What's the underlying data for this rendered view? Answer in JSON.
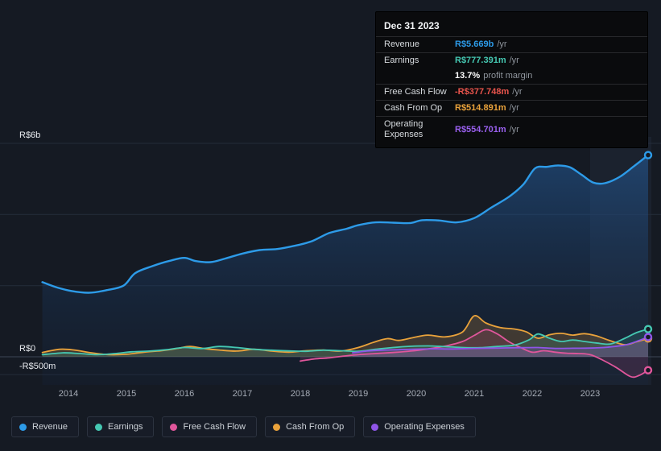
{
  "tooltip": {
    "title": "Dec 31 2023",
    "rows": [
      {
        "label": "Revenue",
        "value": "R$5.669b",
        "suffix": "/yr",
        "color": "#2d9be8",
        "divider": true
      },
      {
        "label": "Earnings",
        "value": "R$777.391m",
        "suffix": "/yr",
        "color": "#45c8b2",
        "divider": true
      },
      {
        "label": "",
        "value": "13.7%",
        "suffix": "profit margin",
        "color": "#ffffff",
        "divider": false
      },
      {
        "label": "Free Cash Flow",
        "value": "-R$377.748m",
        "suffix": "/yr",
        "color": "#e8544c",
        "divider": true
      },
      {
        "label": "Cash From Op",
        "value": "R$514.891m",
        "suffix": "/yr",
        "color": "#e9a23b",
        "divider": true
      },
      {
        "label": "Operating Expenses",
        "value": "R$554.701m",
        "suffix": "/yr",
        "color": "#9a60ef",
        "divider": true
      }
    ]
  },
  "legend": {
    "items": [
      {
        "key": "revenue",
        "label": "Revenue",
        "color": "#2d9be8"
      },
      {
        "key": "earnings",
        "label": "Earnings",
        "color": "#45c8b2"
      },
      {
        "key": "free_cash_flow",
        "label": "Free Cash Flow",
        "color": "#e0569b"
      },
      {
        "key": "cash_from_op",
        "label": "Cash From Op",
        "color": "#e9a23b"
      },
      {
        "key": "operating_expenses",
        "label": "Operating Expenses",
        "color": "#8f55e8"
      }
    ]
  },
  "chart_data": {
    "type": "line",
    "title": "Company financial history (R$, values in millions)",
    "currency": "R$",
    "x_axis": {
      "ticks": [
        2014,
        2015,
        2016,
        2017,
        2018,
        2019,
        2020,
        2021,
        2022,
        2023
      ],
      "range": [
        2013.5,
        2024.0
      ]
    },
    "y_axis": {
      "unit": "R$m",
      "range_m": [
        -800,
        6000
      ],
      "gridlines_m": [
        6000,
        4000,
        2000,
        0,
        -500
      ],
      "labels": [
        {
          "value": 6000,
          "text": "R$6b"
        },
        {
          "value": 0,
          "text": "R$0"
        },
        {
          "value": -500,
          "text": "-R$500m"
        }
      ]
    },
    "highlight_band": {
      "from_year": 2023.0,
      "to_year": 2024.0
    },
    "series": [
      {
        "key": "revenue",
        "name": "Revenue",
        "color": "#2d9be8",
        "fill": "gradient",
        "points": [
          [
            2013.55,
            2100
          ],
          [
            2013.8,
            1950
          ],
          [
            2014.05,
            1850
          ],
          [
            2014.35,
            1800
          ],
          [
            2014.65,
            1870
          ],
          [
            2014.95,
            2000
          ],
          [
            2015.15,
            2350
          ],
          [
            2015.45,
            2550
          ],
          [
            2015.75,
            2700
          ],
          [
            2016.0,
            2780
          ],
          [
            2016.2,
            2690
          ],
          [
            2016.45,
            2660
          ],
          [
            2016.7,
            2760
          ],
          [
            2017.0,
            2900
          ],
          [
            2017.3,
            3000
          ],
          [
            2017.6,
            3030
          ],
          [
            2017.9,
            3120
          ],
          [
            2018.2,
            3250
          ],
          [
            2018.5,
            3480
          ],
          [
            2018.8,
            3600
          ],
          [
            2019.0,
            3700
          ],
          [
            2019.3,
            3780
          ],
          [
            2019.6,
            3770
          ],
          [
            2019.9,
            3760
          ],
          [
            2020.1,
            3840
          ],
          [
            2020.4,
            3830
          ],
          [
            2020.7,
            3780
          ],
          [
            2021.0,
            3900
          ],
          [
            2021.3,
            4200
          ],
          [
            2021.6,
            4500
          ],
          [
            2021.85,
            4850
          ],
          [
            2022.05,
            5300
          ],
          [
            2022.25,
            5340
          ],
          [
            2022.45,
            5380
          ],
          [
            2022.65,
            5330
          ],
          [
            2022.85,
            5120
          ],
          [
            2023.05,
            4900
          ],
          [
            2023.25,
            4880
          ],
          [
            2023.5,
            5050
          ],
          [
            2023.75,
            5350
          ],
          [
            2024.0,
            5669
          ]
        ]
      },
      {
        "key": "cash_from_op",
        "name": "Cash From Op",
        "color": "#e9a23b",
        "fill": "rgba(233,162,59,0.20)",
        "points": [
          [
            2013.55,
            120
          ],
          [
            2013.85,
            210
          ],
          [
            2014.1,
            190
          ],
          [
            2014.4,
            110
          ],
          [
            2014.7,
            60
          ],
          [
            2015.0,
            70
          ],
          [
            2015.3,
            130
          ],
          [
            2015.6,
            170
          ],
          [
            2015.9,
            240
          ],
          [
            2016.1,
            290
          ],
          [
            2016.35,
            230
          ],
          [
            2016.6,
            190
          ],
          [
            2016.9,
            160
          ],
          [
            2017.2,
            210
          ],
          [
            2017.5,
            160
          ],
          [
            2017.8,
            130
          ],
          [
            2018.1,
            170
          ],
          [
            2018.4,
            190
          ],
          [
            2018.7,
            160
          ],
          [
            2019.0,
            260
          ],
          [
            2019.25,
            400
          ],
          [
            2019.5,
            510
          ],
          [
            2019.7,
            460
          ],
          [
            2019.95,
            540
          ],
          [
            2020.2,
            610
          ],
          [
            2020.5,
            560
          ],
          [
            2020.8,
            700
          ],
          [
            2021.0,
            1150
          ],
          [
            2021.2,
            950
          ],
          [
            2021.45,
            820
          ],
          [
            2021.7,
            780
          ],
          [
            2021.9,
            700
          ],
          [
            2022.1,
            520
          ],
          [
            2022.3,
            620
          ],
          [
            2022.5,
            660
          ],
          [
            2022.7,
            610
          ],
          [
            2022.9,
            650
          ],
          [
            2023.1,
            590
          ],
          [
            2023.35,
            450
          ],
          [
            2023.6,
            340
          ],
          [
            2023.8,
            420
          ],
          [
            2024.0,
            515
          ]
        ]
      },
      {
        "key": "free_cash_flow",
        "name": "Free Cash Flow",
        "color": "#e0569b",
        "fill": "rgba(224,86,155,0.14)",
        "points": [
          [
            2018.0,
            -120
          ],
          [
            2018.25,
            -60
          ],
          [
            2018.5,
            -30
          ],
          [
            2018.75,
            20
          ],
          [
            2019.0,
            60
          ],
          [
            2019.3,
            90
          ],
          [
            2019.6,
            120
          ],
          [
            2019.9,
            160
          ],
          [
            2020.2,
            220
          ],
          [
            2020.5,
            300
          ],
          [
            2020.8,
            430
          ],
          [
            2021.0,
            600
          ],
          [
            2021.2,
            760
          ],
          [
            2021.4,
            640
          ],
          [
            2021.6,
            420
          ],
          [
            2021.8,
            260
          ],
          [
            2022.0,
            130
          ],
          [
            2022.2,
            170
          ],
          [
            2022.4,
            130
          ],
          [
            2022.6,
            100
          ],
          [
            2022.8,
            90
          ],
          [
            2023.0,
            60
          ],
          [
            2023.2,
            -80
          ],
          [
            2023.45,
            -300
          ],
          [
            2023.7,
            -560
          ],
          [
            2023.85,
            -520
          ],
          [
            2024.0,
            -378
          ]
        ]
      },
      {
        "key": "earnings",
        "name": "Earnings",
        "color": "#45c8b2",
        "fill": "rgba(69,200,178,0.16)",
        "points": [
          [
            2013.55,
            60
          ],
          [
            2013.9,
            110
          ],
          [
            2014.2,
            90
          ],
          [
            2014.5,
            60
          ],
          [
            2014.8,
            90
          ],
          [
            2015.1,
            140
          ],
          [
            2015.4,
            160
          ],
          [
            2015.7,
            200
          ],
          [
            2016.0,
            260
          ],
          [
            2016.3,
            230
          ],
          [
            2016.6,
            290
          ],
          [
            2016.9,
            260
          ],
          [
            2017.2,
            210
          ],
          [
            2017.5,
            185
          ],
          [
            2017.8,
            165
          ],
          [
            2018.1,
            155
          ],
          [
            2018.4,
            185
          ],
          [
            2018.7,
            170
          ],
          [
            2019.0,
            155
          ],
          [
            2019.3,
            210
          ],
          [
            2019.6,
            260
          ],
          [
            2019.9,
            295
          ],
          [
            2020.2,
            305
          ],
          [
            2020.5,
            285
          ],
          [
            2020.8,
            260
          ],
          [
            2021.1,
            255
          ],
          [
            2021.4,
            290
          ],
          [
            2021.7,
            330
          ],
          [
            2021.95,
            480
          ],
          [
            2022.1,
            640
          ],
          [
            2022.3,
            520
          ],
          [
            2022.5,
            430
          ],
          [
            2022.7,
            470
          ],
          [
            2022.9,
            430
          ],
          [
            2023.1,
            390
          ],
          [
            2023.35,
            360
          ],
          [
            2023.6,
            520
          ],
          [
            2023.8,
            680
          ],
          [
            2024.0,
            777
          ]
        ]
      },
      {
        "key": "operating_expenses",
        "name": "Operating Expenses",
        "color": "#8f55e8",
        "fill": "rgba(143,85,232,0.22)",
        "points": [
          [
            2018.9,
            110
          ],
          [
            2019.15,
            160
          ],
          [
            2019.4,
            185
          ],
          [
            2019.7,
            200
          ],
          [
            2020.0,
            215
          ],
          [
            2020.3,
            225
          ],
          [
            2020.6,
            220
          ],
          [
            2021.0,
            235
          ],
          [
            2021.4,
            245
          ],
          [
            2021.8,
            255
          ],
          [
            2022.1,
            260
          ],
          [
            2022.4,
            235
          ],
          [
            2022.7,
            240
          ],
          [
            2023.0,
            245
          ],
          [
            2023.3,
            270
          ],
          [
            2023.6,
            330
          ],
          [
            2023.8,
            430
          ],
          [
            2024.0,
            555
          ]
        ]
      }
    ]
  }
}
